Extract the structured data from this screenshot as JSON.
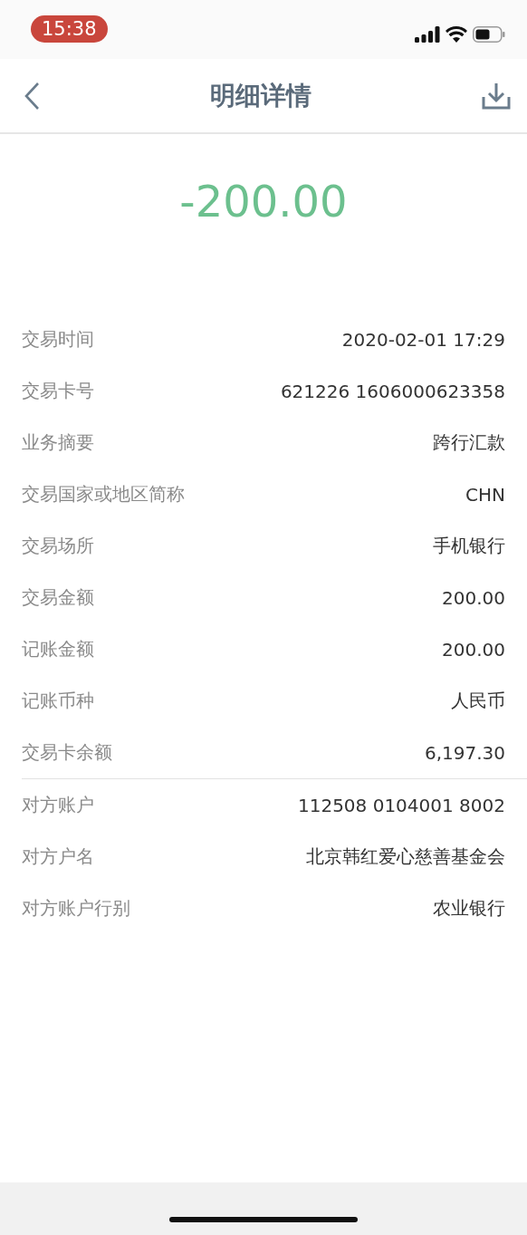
{
  "status_bar": {
    "time": "15:38"
  },
  "nav": {
    "title": "明细详情"
  },
  "amount": "-200.00",
  "sections": [
    {
      "rows": [
        {
          "label": "交易时间",
          "value": "2020-02-01 17:29"
        },
        {
          "label": "交易卡号",
          "value": "621226 1606000623358"
        },
        {
          "label": "业务摘要",
          "value": "跨行汇款"
        },
        {
          "label": "交易国家或地区简称",
          "value": "CHN"
        },
        {
          "label": "交易场所",
          "value": "手机银行"
        },
        {
          "label": "交易金额",
          "value": "200.00"
        },
        {
          "label": "记账金额",
          "value": "200.00"
        },
        {
          "label": "记账币种",
          "value": "人民币"
        },
        {
          "label": "交易卡余额",
          "value": "6,197.30"
        }
      ]
    },
    {
      "rows": [
        {
          "label": "对方账户",
          "value": "112508 0104001 8002"
        },
        {
          "label": "对方户名",
          "value": "北京韩红爱心慈善基金会"
        },
        {
          "label": "对方账户行别",
          "value": "农业银行"
        }
      ]
    }
  ]
}
